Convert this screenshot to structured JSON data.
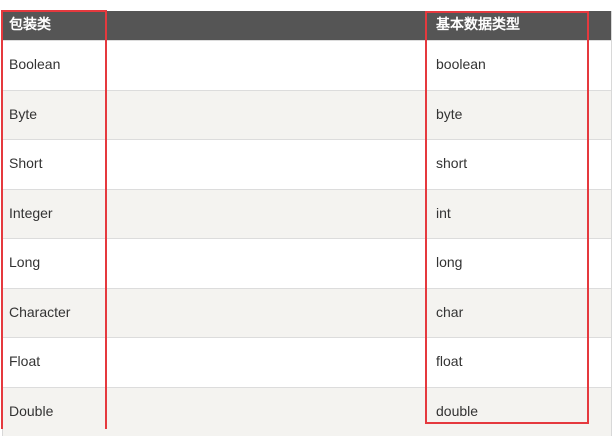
{
  "table": {
    "headers": [
      "包装类",
      "基本数据类型"
    ],
    "rows": [
      [
        "Boolean",
        "boolean"
      ],
      [
        "Byte",
        "byte"
      ],
      [
        "Short",
        "short"
      ],
      [
        "Integer",
        "int"
      ],
      [
        "Long",
        "long"
      ],
      [
        "Character",
        "char"
      ],
      [
        "Float",
        "float"
      ],
      [
        "Double",
        "double"
      ]
    ]
  },
  "colors": {
    "header_bg": "#555555",
    "row_alt_bg": "#f4f3f0",
    "highlight_border": "#e5393e"
  }
}
